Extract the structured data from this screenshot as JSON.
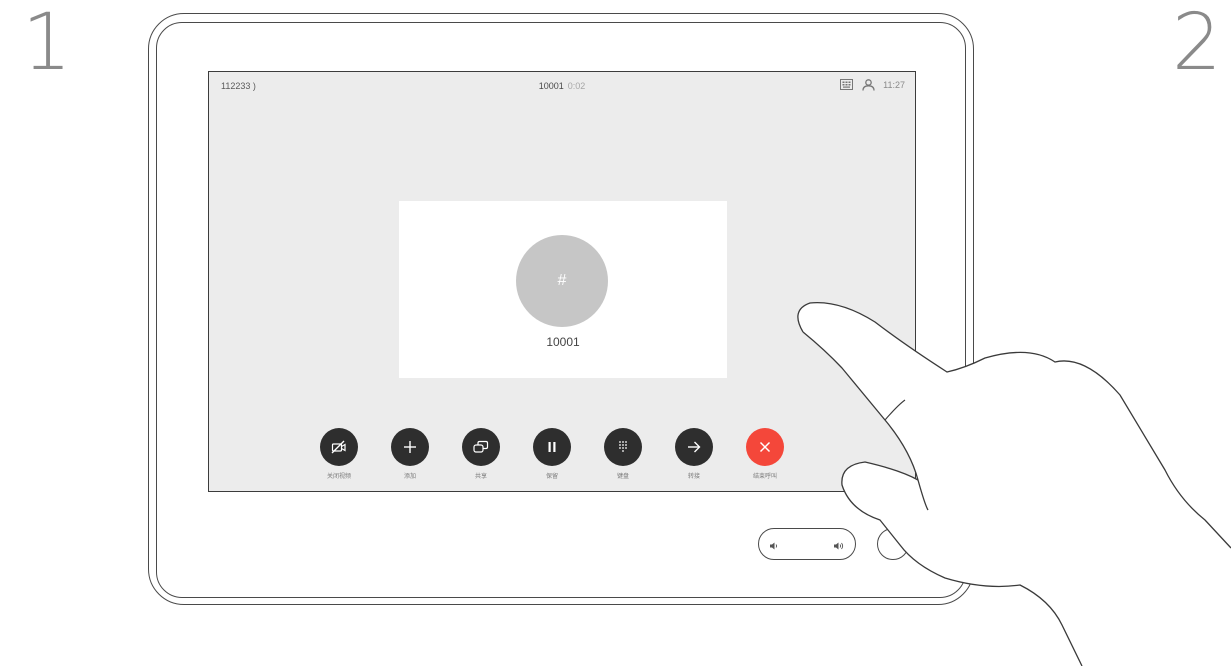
{
  "steps": {
    "first": "1",
    "second": "2"
  },
  "status_bar": {
    "left_text": "112233 )",
    "center_number": "10001",
    "center_sub": "0:02",
    "time": "11:27",
    "icons": [
      "keypad-icon",
      "contacts-icon"
    ]
  },
  "call": {
    "avatar_glyph": "#",
    "number": "10001"
  },
  "controls": [
    {
      "name": "camera-off",
      "icon": "camera-off-icon",
      "label": "关闭视频",
      "color": "#2e2e2e"
    },
    {
      "name": "add",
      "icon": "plus-icon",
      "label": "添加",
      "color": "#2e2e2e"
    },
    {
      "name": "share",
      "icon": "share-icon",
      "label": "共享",
      "color": "#2e2e2e"
    },
    {
      "name": "hold",
      "icon": "pause-icon",
      "label": "保留",
      "color": "#2e2e2e"
    },
    {
      "name": "keypad",
      "icon": "keypad-icon",
      "label": "键盘",
      "color": "#2e2e2e"
    },
    {
      "name": "transfer",
      "icon": "arrow-right-icon",
      "label": "转接",
      "color": "#2e2e2e"
    },
    {
      "name": "end-call",
      "icon": "close-icon",
      "label": "结束呼叫",
      "color": "#f4473a"
    }
  ],
  "hardware": {
    "volume_down_icon": "volume-down-icon",
    "volume_up_icon": "volume-up-icon",
    "power_icon": "power-icon"
  }
}
